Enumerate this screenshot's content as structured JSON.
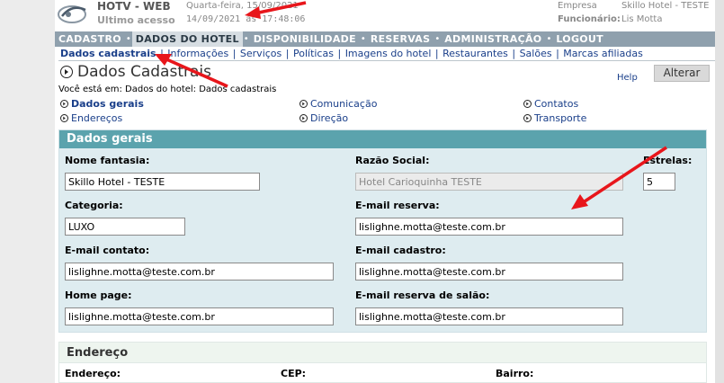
{
  "header": {
    "app_title": "HOTV - WEB",
    "last_access_label": "Ultimo acesso",
    "date_line": "Quarta-feira, 15/09/2021",
    "access_time": "14/09/2021  às  17:48:06",
    "empresa_label": "Empresa",
    "empresa_value": "Skillo Hotel - TESTE",
    "funcionario_label": "Funcionário:",
    "funcionario_value": "Lis Motta"
  },
  "topnav": [
    {
      "label": "CADASTRO"
    },
    {
      "label": "DADOS DO HOTEL"
    },
    {
      "label": "DISPONIBILIDADE"
    },
    {
      "label": "RESERVAS"
    },
    {
      "label": "ADMINISTRAÇÃO"
    },
    {
      "label": "LOGOUT"
    }
  ],
  "topnav_sep": "•",
  "subnav": [
    {
      "label": "Dados cadastrais"
    },
    {
      "label": "Informações"
    },
    {
      "label": "Serviços"
    },
    {
      "label": "Políticas"
    },
    {
      "label": "Imagens do hotel"
    },
    {
      "label": "Restaurantes"
    },
    {
      "label": "Salões"
    },
    {
      "label": "Marcas afiliadas"
    }
  ],
  "subnav_sep": "|",
  "page_title": "Dados Cadastrais",
  "help_label": "Help",
  "alterar_label": "Alterar",
  "breadcrumb": "Você está em: Dados do hotel: Dados cadastrais",
  "sections": [
    {
      "label": "Dados gerais"
    },
    {
      "label": "Endereços"
    },
    {
      "label": "Comunicação"
    },
    {
      "label": "Direção"
    },
    {
      "label": "Contatos"
    },
    {
      "label": "Transporte"
    }
  ],
  "dados_gerais": {
    "title": "Dados gerais",
    "nome_fantasia_label": "Nome fantasia:",
    "nome_fantasia_value": "Skillo Hotel - TESTE",
    "razao_social_label": "Razão Social:",
    "razao_social_value": "Hotel Carioquinha TESTE",
    "estrelas_label": "Estrelas:",
    "estrelas_value": "5",
    "categoria_label": "Categoria:",
    "categoria_value": "LUXO",
    "email_reserva_label": "E-mail reserva:",
    "email_reserva_value": "lislighne.motta@teste.com.br",
    "email_contato_label": "E-mail contato:",
    "email_contato_value": "lislighne.motta@teste.com.br",
    "email_cadastro_label": "E-mail cadastro:",
    "email_cadastro_value": "lislighne.motta@teste.com.br",
    "home_page_label": "Home page:",
    "home_page_value": "lislighne.motta@teste.com.br",
    "email_salao_label": "E-mail reserva de salão:",
    "email_salao_value": "lislighne.motta@teste.com.br"
  },
  "endereco": {
    "title": "Endereço",
    "endereco_label": "Endereço:",
    "cep_label": "CEP:",
    "bairro_label": "Bairro:"
  },
  "colors": {
    "nav_bg": "#8fa0ad",
    "panel_header": "#5ba3ad",
    "panel_bg": "#deecf0",
    "link": "#1a3f8a",
    "annotation": "#e8161b"
  }
}
